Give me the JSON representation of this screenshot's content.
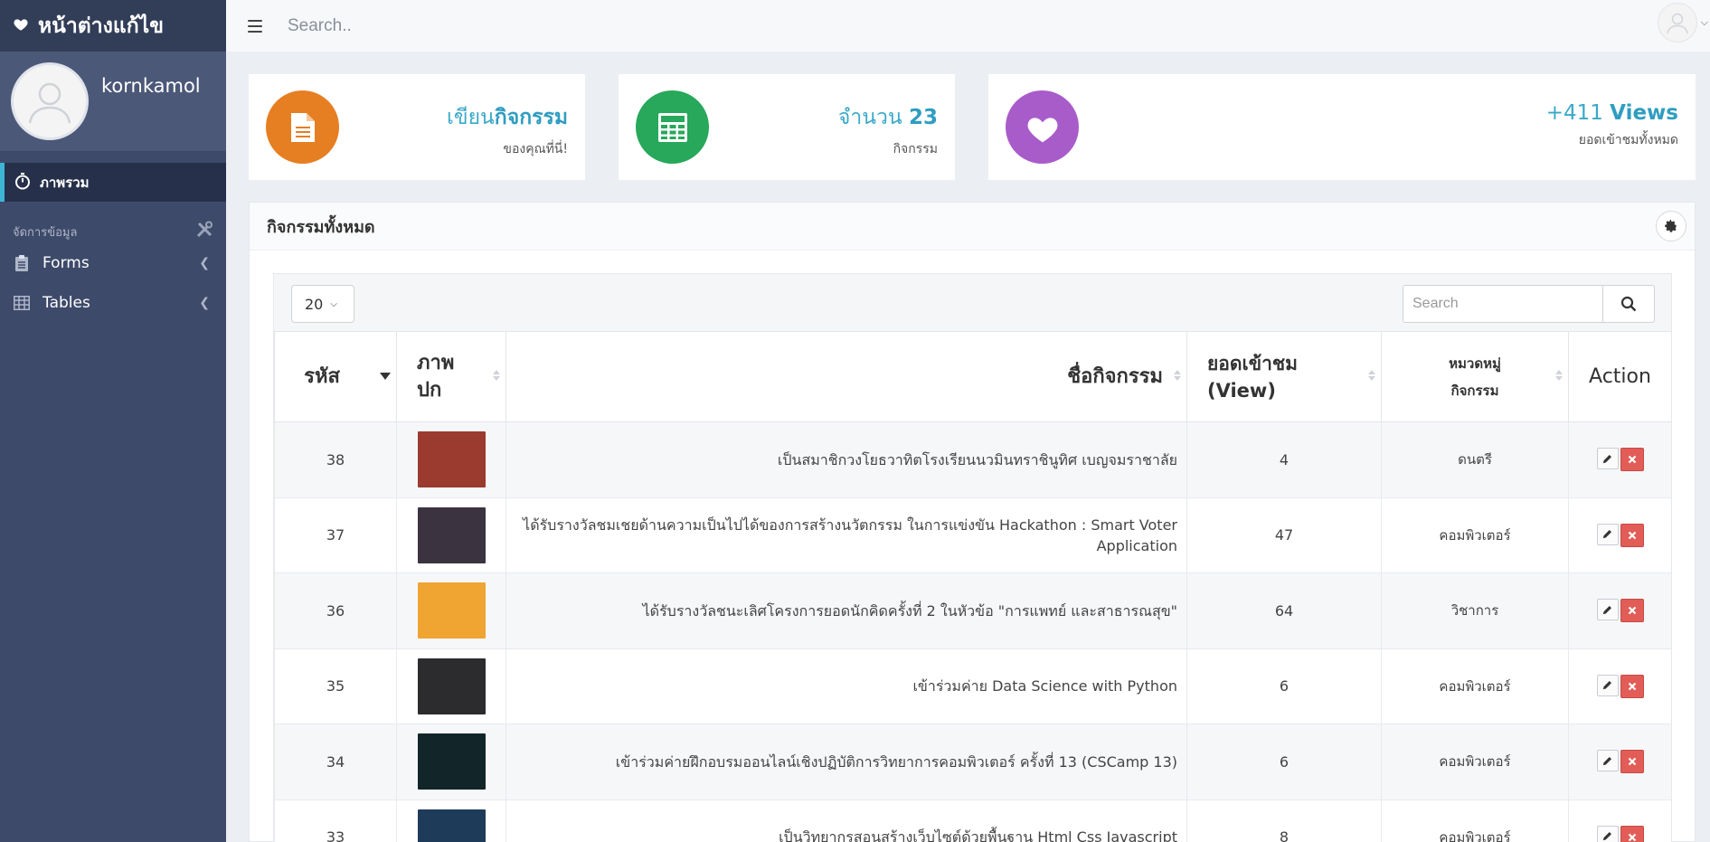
{
  "brand": {
    "title": "หน้าต่างแก้ไข",
    "icon": "heart-icon"
  },
  "profile": {
    "name": "kornkamol"
  },
  "sidebar": {
    "active_item": "ภาพรวม",
    "section_label": "จัดการข้อมูล",
    "items": [
      {
        "label": "Forms",
        "icon": "clipboard-icon"
      },
      {
        "label": "Tables",
        "icon": "table-icon"
      }
    ]
  },
  "topbar": {
    "search_placeholder": "Search.."
  },
  "stats": [
    {
      "line1_plain": "เขียน",
      "line1_bold": "กิจกรรม",
      "line2": "ของคุณที่นี่!",
      "color": "#e67e22",
      "icon": "document-icon"
    },
    {
      "line1_plain": "จำนวน ",
      "line1_bold": "23",
      "line2": "กิจกรรม",
      "color": "#27a85a",
      "icon": "calculator-icon"
    },
    {
      "line1_plain": "+411 ",
      "line1_bold": "Views",
      "line2": "ยอดเข้าชมทั้งหมด",
      "color": "#a85cc9",
      "icon": "heart-icon"
    }
  ],
  "panel": {
    "title": "กิจกรรมทั้งหมด"
  },
  "table_controls": {
    "page_length": "20",
    "search_placeholder": "Search"
  },
  "table": {
    "headers": [
      "รหัส",
      "ภาพ\nปก",
      "ชื่อกิจกรรม",
      "ยอดเข้าชม\n(View)",
      "หมวดหมู่\nกิจกรรม",
      "Action"
    ],
    "rows": [
      {
        "id": "38",
        "name": "เป็นสมาชิกวงโยธวาทิตโรงเรียนนวมินทราชินูทิศ เบญจมราชาลัย",
        "views": "4",
        "category": "ดนตรี",
        "thumb": "#9b3a2e"
      },
      {
        "id": "37",
        "name": "ได้รับรางวัลชมเชยด้านความเป็นไปได้ของการสร้างนวัตกรรม ในการแข่งขัน Hackathon : Smart Voter Application",
        "views": "47",
        "category": "คอมพิวเตอร์",
        "thumb": "#3b3440"
      },
      {
        "id": "36",
        "name": "ได้รับรางวัลชนะเลิศโครงการยอดนักคิดครั้งที่ 2 ในหัวข้อ \"การแพทย์ และสาธารณสุข\"",
        "views": "64",
        "category": "วิชาการ",
        "thumb": "#f0a431"
      },
      {
        "id": "35",
        "name": "เข้าร่วมค่าย Data Science with Python",
        "views": "6",
        "category": "คอมพิวเตอร์",
        "thumb": "#2c2c2e"
      },
      {
        "id": "34",
        "name": "เข้าร่วมค่ายฝึกอบรมออนไลน์เชิงปฏิบัติการวิทยาการคอมพิวเตอร์ ครั้งที่ 13 (CSCamp 13)",
        "views": "6",
        "category": "คอมพิวเตอร์",
        "thumb": "#12262a"
      },
      {
        "id": "33",
        "name": "เป็นวิทยากรสอนสร้างเว็บไซต์ด้วยพื้นฐาน Html Css Javascript",
        "views": "8",
        "category": "คอมพิวเตอร์",
        "thumb": "#1f3b5a"
      }
    ]
  }
}
